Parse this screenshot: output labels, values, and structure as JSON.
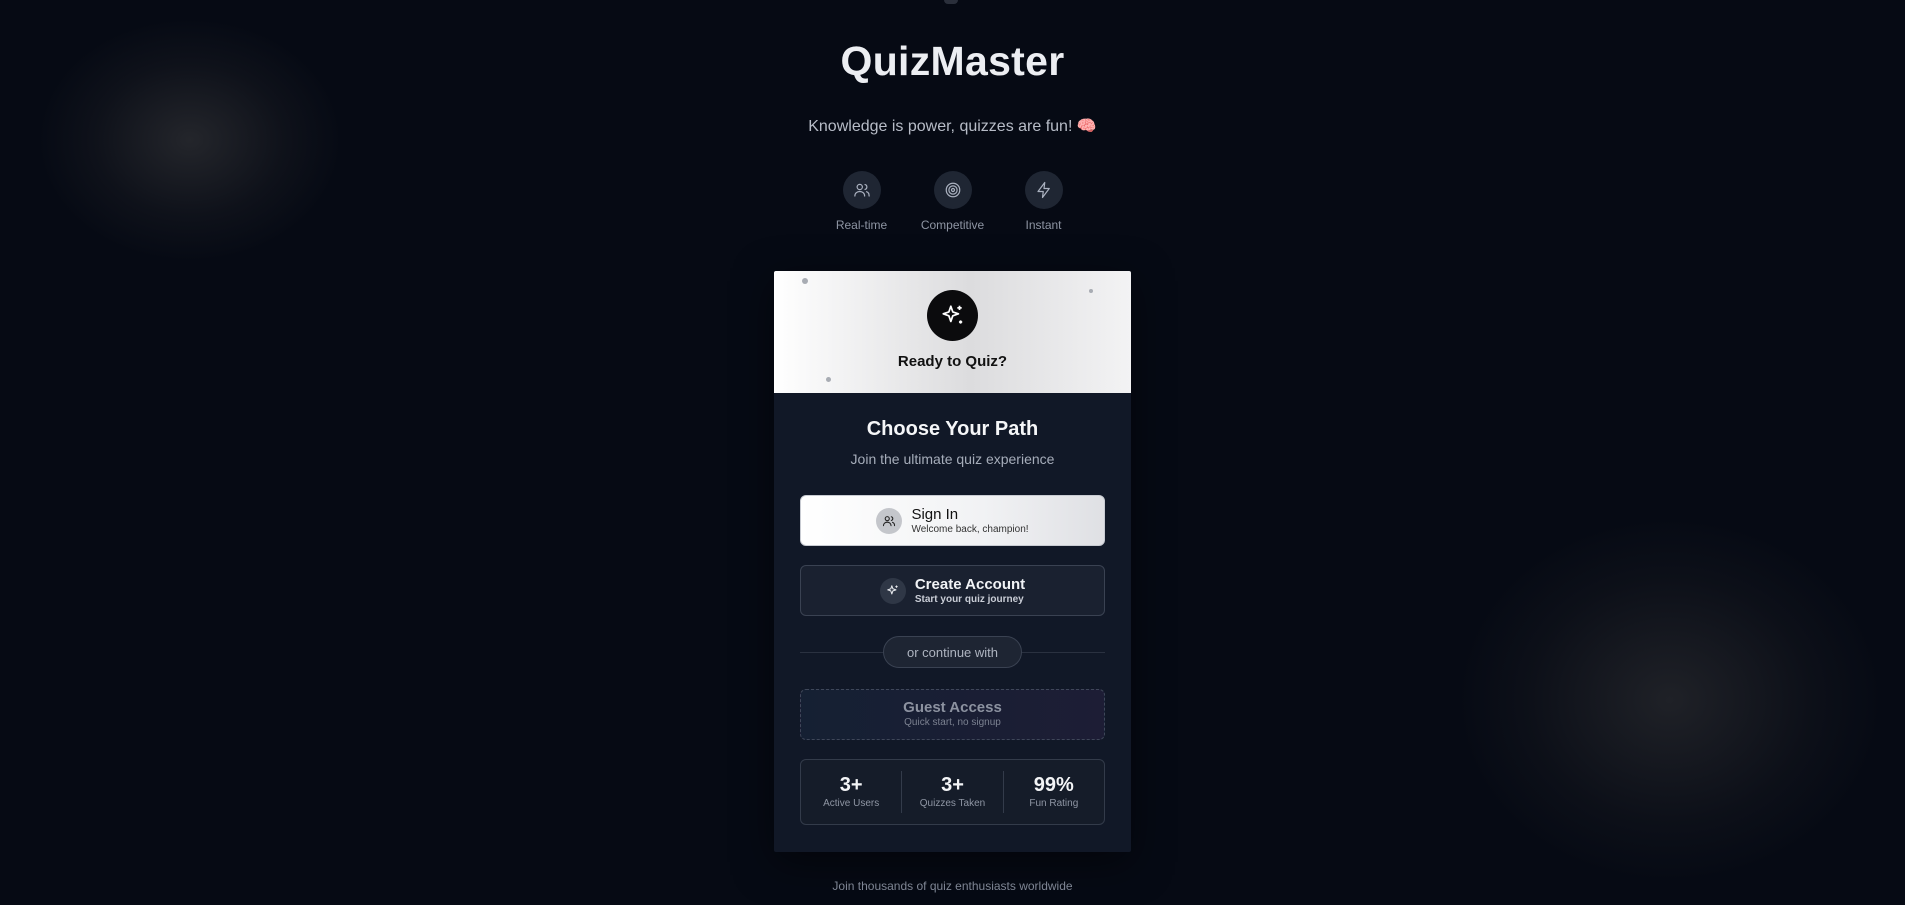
{
  "app": {
    "title": "QuizMaster",
    "tagline": "Knowledge is power, quizzes are fun! 🧠"
  },
  "features": [
    {
      "label": "Real-time",
      "icon": "users-icon"
    },
    {
      "label": "Competitive",
      "icon": "target-icon"
    },
    {
      "label": "Instant",
      "icon": "lightning-icon"
    }
  ],
  "card": {
    "header_text": "Ready to Quiz?",
    "header_icon": "sparkles-icon",
    "heading": "Choose Your Path",
    "subheading": "Join the ultimate quiz experience",
    "signin": {
      "title": "Sign In",
      "subtitle": "Welcome back, champion!",
      "icon": "users-icon"
    },
    "create": {
      "title": "Create Account",
      "subtitle": "Start your quiz journey",
      "icon": "sparkles-icon"
    },
    "divider": "or continue with",
    "guest": {
      "title": "Guest Access",
      "subtitle": "Quick start, no signup"
    },
    "stats": [
      {
        "value": "3+",
        "label": "Active Users"
      },
      {
        "value": "3+",
        "label": "Quizzes Taken"
      },
      {
        "value": "99%",
        "label": "Fun Rating"
      }
    ]
  },
  "footer": "Join thousands of quiz enthusiasts worldwide",
  "colors": {
    "background": "#060a14",
    "card": "#111827",
    "accent": "#ffffff"
  }
}
